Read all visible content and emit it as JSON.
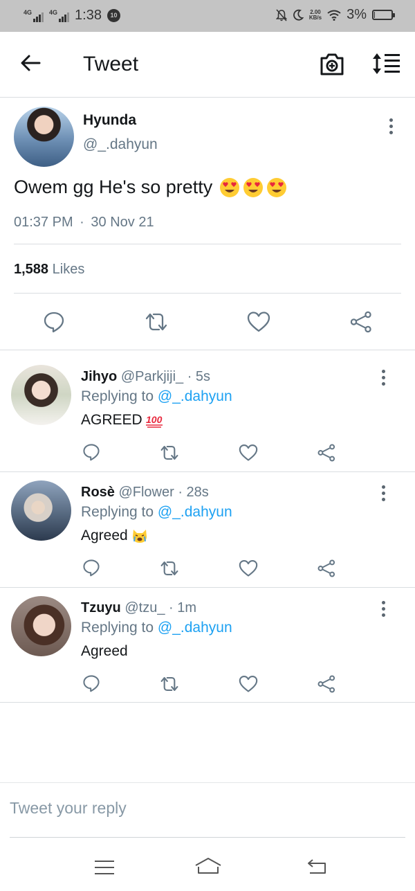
{
  "status_bar": {
    "network1": "4G",
    "network2": "4G",
    "time": "1:38",
    "notification_badge": "10",
    "speed_value": "2.00",
    "speed_unit": "KB/s",
    "battery": "3%",
    "battery_level": 0.03
  },
  "header": {
    "title": "Tweet",
    "icons": [
      "back-arrow-icon",
      "camera-icon",
      "sort-icon"
    ]
  },
  "tweet": {
    "name": "Hyunda",
    "handle": "@_.dahyun",
    "text": "Owem gg He's so pretty",
    "emoji": "heart-eyes x3",
    "time": "01:37 PM",
    "date": "30 Nov 21",
    "dot": "·",
    "likes_count": "1,588",
    "likes_label": "Likes"
  },
  "replies": [
    {
      "name": "Jihyo",
      "handle": "@Parkjiji_",
      "time": "· 5s",
      "replying_prefix": "Replying to",
      "replying_to": "@_.dahyun",
      "text": "AGREED",
      "emoji": "100"
    },
    {
      "name": "Rosè",
      "handle": "@Flower",
      "time": "· 28s",
      "replying_prefix": "Replying to",
      "replying_to": "@_.dahyun",
      "text": "Agreed",
      "emoji": "crying-cat"
    },
    {
      "name": "Tzuyu",
      "handle": "@tzu_",
      "time": "· 1m",
      "replying_prefix": "Replying to",
      "replying_to": "@_.dahyun",
      "text": "Agreed",
      "emoji": ""
    }
  ],
  "composer": {
    "placeholder": "Tweet your reply",
    "value": ""
  },
  "colors": {
    "accent": "#1da1f2",
    "text": "#14171a",
    "secondary": "#657786",
    "icon": "#657786",
    "status_bar": "#c4c4c4"
  }
}
